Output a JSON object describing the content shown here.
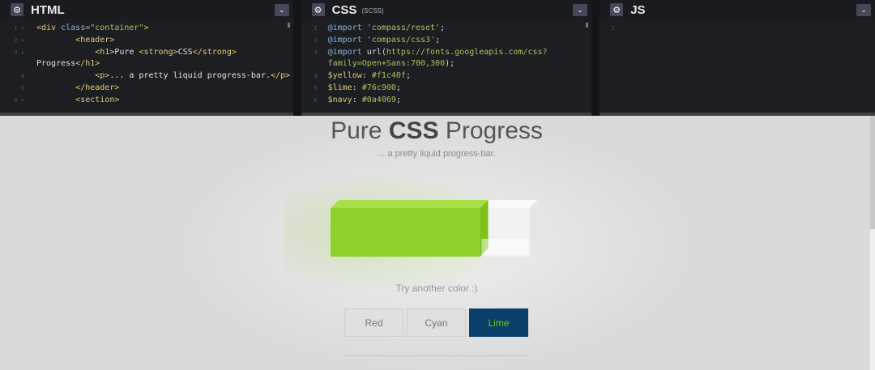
{
  "editors": {
    "html": {
      "title": "HTML",
      "lines": [
        {
          "n": "1",
          "fold": "▾",
          "parts": [
            {
              "c": "t-tag",
              "t": "<div "
            },
            {
              "c": "t-attr",
              "t": "class="
            },
            {
              "c": "t-str",
              "t": "\"container\""
            },
            {
              "c": "t-tag",
              "t": ">"
            }
          ]
        },
        {
          "n": "2",
          "fold": "▾",
          "parts": [
            {
              "c": "t-plain",
              "t": "        "
            },
            {
              "c": "t-tag",
              "t": "<header>"
            }
          ]
        },
        {
          "n": "3",
          "fold": "▾",
          "parts": [
            {
              "c": "t-plain",
              "t": "            "
            },
            {
              "c": "t-tag",
              "t": "<h1>"
            },
            {
              "c": "t-plain",
              "t": "Pure "
            },
            {
              "c": "t-tag",
              "t": "<strong>"
            },
            {
              "c": "t-plain",
              "t": "CSS"
            },
            {
              "c": "t-tag",
              "t": "</strong>"
            }
          ]
        },
        {
          "n": "",
          "fold": "",
          "parts": [
            {
              "c": "t-plain",
              "t": "Progress"
            },
            {
              "c": "t-tag",
              "t": "</h1>"
            }
          ]
        },
        {
          "n": "4",
          "fold": "",
          "parts": [
            {
              "c": "t-plain",
              "t": "            "
            },
            {
              "c": "t-tag",
              "t": "<p>"
            },
            {
              "c": "t-plain",
              "t": "... a pretty liquid progress-bar."
            },
            {
              "c": "t-tag",
              "t": "</p>"
            }
          ]
        },
        {
          "n": "5",
          "fold": "",
          "parts": [
            {
              "c": "t-plain",
              "t": "        "
            },
            {
              "c": "t-tag",
              "t": "</header>"
            }
          ]
        },
        {
          "n": "6",
          "fold": "▾",
          "parts": [
            {
              "c": "t-plain",
              "t": "        "
            },
            {
              "c": "t-tag",
              "t": "<section>"
            }
          ]
        }
      ]
    },
    "css": {
      "title": "CSS",
      "subtitle": "(SCSS)",
      "lines": [
        {
          "n": "1",
          "parts": [
            {
              "c": "t-kw",
              "t": "@import "
            },
            {
              "c": "t-str",
              "t": "'compass/reset'"
            },
            {
              "c": "t-plain",
              "t": ";"
            }
          ]
        },
        {
          "n": "2",
          "parts": [
            {
              "c": "t-kw",
              "t": "@import "
            },
            {
              "c": "t-str",
              "t": "'compass/css3'"
            },
            {
              "c": "t-plain",
              "t": ";"
            }
          ]
        },
        {
          "n": "3",
          "parts": [
            {
              "c": "t-kw",
              "t": "@import "
            },
            {
              "c": "t-plain",
              "t": "url("
            },
            {
              "c": "t-str",
              "t": "https://fonts.googleapis.com/css?"
            }
          ]
        },
        {
          "n": "",
          "parts": [
            {
              "c": "t-str",
              "t": "family=Open+Sans:700,300"
            },
            {
              "c": "t-plain",
              "t": ");"
            }
          ]
        },
        {
          "n": "4",
          "parts": [
            {
              "c": "t-var",
              "t": "$yellow"
            },
            {
              "c": "t-plain",
              "t": ": "
            },
            {
              "c": "t-str",
              "t": "#f1c40f"
            },
            {
              "c": "t-plain",
              "t": ";"
            }
          ]
        },
        {
          "n": "5",
          "parts": [
            {
              "c": "t-var",
              "t": "$lime"
            },
            {
              "c": "t-plain",
              "t": ": "
            },
            {
              "c": "t-str",
              "t": "#76c900"
            },
            {
              "c": "t-plain",
              "t": ";"
            }
          ]
        },
        {
          "n": "6",
          "parts": [
            {
              "c": "t-var",
              "t": "$navy"
            },
            {
              "c": "t-plain",
              "t": ": "
            },
            {
              "c": "t-str",
              "t": "#0a4069"
            },
            {
              "c": "t-plain",
              "t": ";"
            }
          ]
        }
      ]
    },
    "js": {
      "title": "JS",
      "lines": [
        {
          "n": "1",
          "parts": []
        }
      ]
    }
  },
  "preview": {
    "title_light_before": "Pure ",
    "title_bold": "CSS",
    "title_light_after": " Progress",
    "subtitle": "... a pretty liquid progress-bar.",
    "progress_fraction": 0.75,
    "progress_color": "#8fd12b",
    "try_text": "Try another color :)",
    "buttons": [
      {
        "label": "Red",
        "active": false
      },
      {
        "label": "Cyan",
        "active": false
      },
      {
        "label": "Lime",
        "active": true
      }
    ],
    "colors": {
      "lime": "#76c900",
      "navy": "#0a4069",
      "yellow": "#f1c40f"
    }
  },
  "icons": {
    "settings": "gear-icon",
    "collapse": "chevron-down-icon"
  }
}
